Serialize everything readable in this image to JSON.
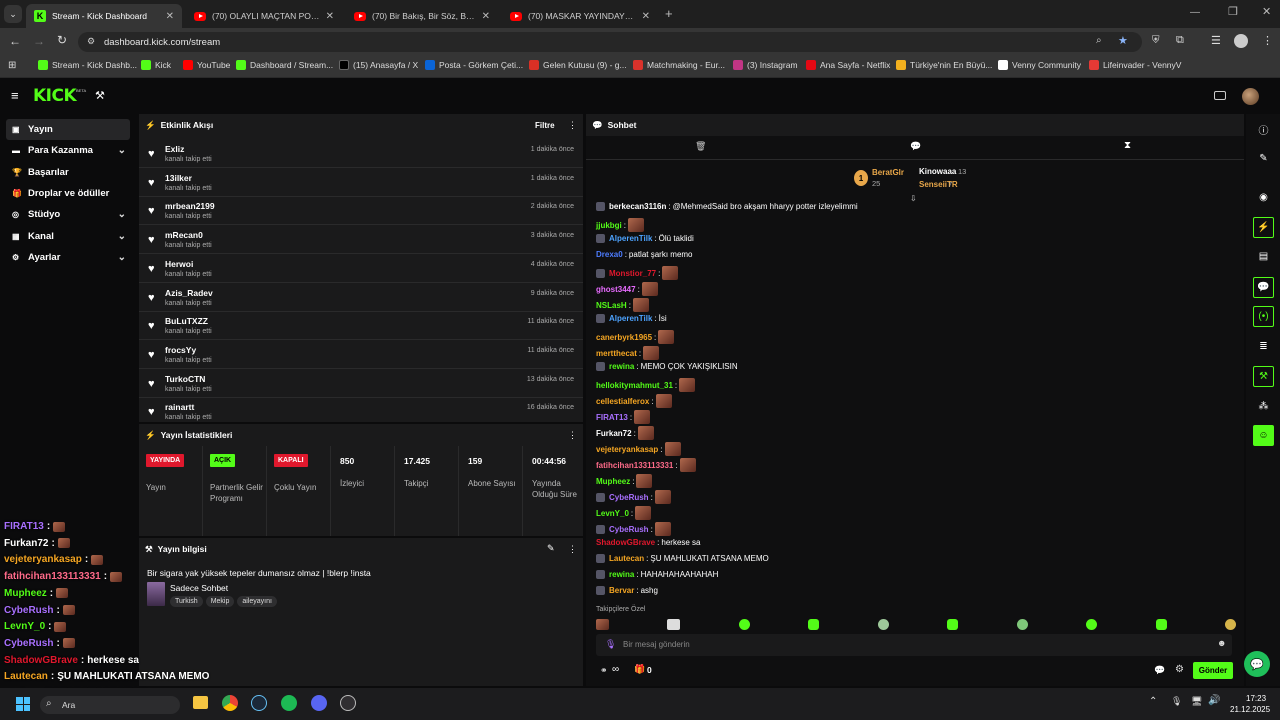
{
  "browser": {
    "tabs": [
      {
        "title": "Stream - Kick Dashboard",
        "icon": "kick-icon",
        "active": true
      },
      {
        "title": "(70) OLAYLI MAÇTAN POLİS EŞ...",
        "icon": "youtube-icon",
        "active": false
      },
      {
        "title": "(70) Bir Bakış, Bir Söz, Bir Ömür...",
        "icon": "youtube-icon",
        "active": false
      },
      {
        "title": "(70) MASKAR YAYINDAYKEN TE...",
        "icon": "youtube-icon",
        "active": false
      }
    ],
    "url": "dashboard.kick.com/stream",
    "bookmarks": [
      {
        "label": "Stream - Kick Dashb...",
        "color": "#53fc18"
      },
      {
        "label": "Kick",
        "color": "#53fc18"
      },
      {
        "label": "YouTube",
        "color": "#ff0000"
      },
      {
        "label": "Dashboard / Stream...",
        "color": "#53fc18"
      },
      {
        "label": "(15) Anasayfa / X",
        "color": "#000000"
      },
      {
        "label": "Posta - Görkem Çeti...",
        "color": "#0a64d6"
      },
      {
        "label": "Gelen Kutusu (9) - g...",
        "color": "#d93025"
      },
      {
        "label": "Matchmaking - Eur...",
        "color": "#d9322b"
      },
      {
        "label": "(3) Instagram",
        "color": "#c13584"
      },
      {
        "label": "Ana Sayfa - Netflix",
        "color": "#e50914"
      },
      {
        "label": "Türkiye'nin En Büyü...",
        "color": "#f2b01e"
      },
      {
        "label": "Venny Community",
        "color": "#ffffff"
      },
      {
        "label": "Lifeinvader - VennyV",
        "color": "#e53935"
      }
    ]
  },
  "app": {
    "logo": "KICK",
    "logo_badge": "BETA"
  },
  "sidebar": {
    "items": [
      {
        "label": "Yayın",
        "icon": "stream-icon",
        "chevron": false,
        "active": true
      },
      {
        "label": "Para Kazanma",
        "icon": "money-icon",
        "chevron": true,
        "active": false
      },
      {
        "label": "Başarılar",
        "icon": "trophy-icon",
        "chevron": false,
        "active": false
      },
      {
        "label": "Droplar ve ödüller",
        "icon": "gift-icon",
        "chevron": false,
        "active": false
      },
      {
        "label": "Stüdyo",
        "icon": "studio-icon",
        "chevron": true,
        "active": false
      },
      {
        "label": "Kanal",
        "icon": "channel-icon",
        "chevron": true,
        "active": false
      },
      {
        "label": "Ayarlar",
        "icon": "gear-icon",
        "chevron": true,
        "active": false
      }
    ]
  },
  "activity": {
    "title": "Etkinlik Akışı",
    "filter_label": "Filtre",
    "items": [
      {
        "name": "Exliz",
        "sub": "kanalı takip etti",
        "time": "1 dakika önce"
      },
      {
        "name": "13ilker",
        "sub": "kanalı takip etti",
        "time": "1 dakika önce"
      },
      {
        "name": "mrbean2199",
        "sub": "kanalı takip etti",
        "time": "2 dakika önce"
      },
      {
        "name": "mRecan0",
        "sub": "kanalı takip etti",
        "time": "3 dakika önce"
      },
      {
        "name": "Herwoi",
        "sub": "kanalı takip etti",
        "time": "4 dakika önce"
      },
      {
        "name": "Azis_Radev",
        "sub": "kanalı takip etti",
        "time": "9 dakika önce"
      },
      {
        "name": "BuLuTXZZ",
        "sub": "kanalı takip etti",
        "time": "11 dakika önce"
      },
      {
        "name": "frocsYy",
        "sub": "kanalı takip etti",
        "time": "11 dakika önce"
      },
      {
        "name": "TurkoCTN",
        "sub": "kanalı takip etti",
        "time": "13 dakika önce"
      },
      {
        "name": "rainartt",
        "sub": "kanalı takip etti",
        "time": "16 dakika önce"
      }
    ]
  },
  "stats": {
    "title": "Yayın İstatistikleri",
    "status": [
      {
        "badge": "YAYINDA",
        "label": "Yayın",
        "color": "#e0182d",
        "text_color": "#ffffff"
      },
      {
        "badge": "AÇIK",
        "label": "Partnerlik Gelir Programı",
        "color": "#53fc18",
        "text_color": "#000000"
      },
      {
        "badge": "KAPALI",
        "label": "Çoklu Yayın",
        "color": "#e0182d",
        "text_color": "#ffffff"
      }
    ],
    "metrics": [
      {
        "value": "850",
        "label": "İzleyici"
      },
      {
        "value": "17.425",
        "label": "Takipçi"
      },
      {
        "value": "159",
        "label": "Abone Sayısı"
      },
      {
        "value": "00:44:56",
        "label": "Yayında Olduğu Süre"
      }
    ]
  },
  "info": {
    "title": "Yayın bilgisi",
    "stream_title": "Bir sigara yak yüksek tepeler dumansız olmaz | !blerp !insta",
    "category": "Sadece Sohbet",
    "tags": [
      "Turkish",
      "Mekip",
      "aileyayını"
    ]
  },
  "chat": {
    "title": "Sohbet",
    "leaderboard": [
      {
        "rank": "1",
        "name": "BeratGlr",
        "count": "25",
        "color": "#e8a74a"
      },
      {
        "name": "Kinowaaa",
        "count": "13",
        "color": "#ffffff"
      },
      {
        "name": "SenseiiTR",
        "count": "7",
        "color": "#e8a74a"
      }
    ],
    "messages": [
      {
        "user": "berkecan3116n",
        "color": "#ffffff",
        "text": "@MehmedSaid bro akşam hharyy potter izleyelimmi",
        "badge": true,
        "emote": false
      },
      {
        "user": "jjukbgi",
        "color": "#53fc18",
        "text": "",
        "badge": false,
        "emote": true
      },
      {
        "user": "AlperenTilk",
        "color": "#4da3ff",
        "text": "Ölü taklidi",
        "badge": true,
        "emote": false
      },
      {
        "user": "Drexa0",
        "color": "#4d7cff",
        "text": "patlat şarkı memo",
        "badge": false,
        "emote": false
      },
      {
        "user": "Monstior_77",
        "color": "#e0182d",
        "text": "",
        "badge": true,
        "emote": true
      },
      {
        "user": "ghost3447",
        "color": "#e86cff",
        "text": "",
        "badge": false,
        "emote": true
      },
      {
        "user": "NSLasH",
        "color": "#53fc18",
        "text": "",
        "badge": false,
        "emote": true
      },
      {
        "user": "AlperenTilk",
        "color": "#4da3ff",
        "text": "İsi",
        "badge": true,
        "emote": false
      },
      {
        "user": "canerbyrk1965",
        "color": "#f5a623",
        "text": "",
        "badge": false,
        "emote": true
      },
      {
        "user": "mertthecat",
        "color": "#f5a623",
        "text": "",
        "badge": false,
        "emote": true
      },
      {
        "user": "rewina",
        "color": "#53fc18",
        "text": "MEMO ÇOK YAKIŞIKLISIN",
        "badge": true,
        "emote": false
      },
      {
        "user": "hellokitymahmut_31",
        "color": "#53fc18",
        "text": "",
        "badge": false,
        "emote": true
      },
      {
        "user": "cellestialferox",
        "color": "#f5a623",
        "text": "",
        "badge": false,
        "emote": true
      },
      {
        "user": "FIRAT13",
        "color": "#a970ff",
        "text": "",
        "badge": false,
        "emote": true
      },
      {
        "user": "Furkan72",
        "color": "#ffffff",
        "text": "",
        "badge": false,
        "emote": true
      },
      {
        "user": "vejeteryankasap",
        "color": "#f5a623",
        "text": "",
        "badge": false,
        "emote": true
      },
      {
        "user": "fatihcihan133113331",
        "color": "#ff6b8a",
        "text": "",
        "badge": false,
        "emote": true
      },
      {
        "user": "Mupheez",
        "color": "#53fc18",
        "text": "",
        "badge": false,
        "emote": true
      },
      {
        "user": "CybeRush",
        "color": "#a970ff",
        "text": "",
        "badge": true,
        "emote": true
      },
      {
        "user": "LevnY_0",
        "color": "#53fc18",
        "text": "",
        "badge": false,
        "emote": true
      },
      {
        "user": "CybeRush",
        "color": "#a970ff",
        "text": "",
        "badge": true,
        "emote": true
      },
      {
        "user": "ShadowGBrave",
        "color": "#e0182d",
        "text": "herkese sa",
        "badge": false,
        "emote": false
      },
      {
        "user": "Lautecan",
        "color": "#f5a623",
        "text": "ŞU MAHLUKATI ATSANA MEMO",
        "badge": true,
        "emote": false
      },
      {
        "user": "rewina",
        "color": "#53fc18",
        "text": "HAHAHAHAAHAHAH",
        "badge": true,
        "emote": false
      },
      {
        "user": "Bervar",
        "color": "#f5a623",
        "text": "ashg",
        "badge": true,
        "emote": false
      }
    ],
    "emote_tab_label": "Takipçilere Özel",
    "input_placeholder": "Bir mesaj gönderin",
    "send_label": "Gönder",
    "footer_counts": {
      "followers": "∞",
      "gifts": "0"
    }
  },
  "overlay": {
    "messages": [
      {
        "user": "FIRAT13",
        "color": "#a970ff",
        "text": ""
      },
      {
        "user": "Furkan72",
        "color": "#ffffff",
        "text": ""
      },
      {
        "user": "vejeteryankasap",
        "color": "#f5a623",
        "text": ""
      },
      {
        "user": "fatihcihan133113331",
        "color": "#ff6b8a",
        "text": ""
      },
      {
        "user": "Mupheez",
        "color": "#53fc18",
        "text": ""
      },
      {
        "user": "CybeRush",
        "color": "#a970ff",
        "text": ""
      },
      {
        "user": "LevnY_0",
        "color": "#53fc18",
        "text": ""
      },
      {
        "user": "CybeRush",
        "color": "#a970ff",
        "text": ""
      },
      {
        "user": "ShadowGBrave",
        "color": "#e0182d",
        "text": "herkese sa"
      },
      {
        "user": "Lautecan",
        "color": "#f5a623",
        "text": "ŞU MAHLUKATI ATSANA MEMO"
      },
      {
        "user": "rewina",
        "color": "#53fc18",
        "text": "HAHAHAHAAHAHAH"
      },
      {
        "user": "Bervar",
        "color": "#f5a623",
        "text": "ashg"
      }
    ]
  },
  "taskbar": {
    "search_placeholder": "Ara",
    "time": "17:23",
    "date": "21.12.2025"
  }
}
